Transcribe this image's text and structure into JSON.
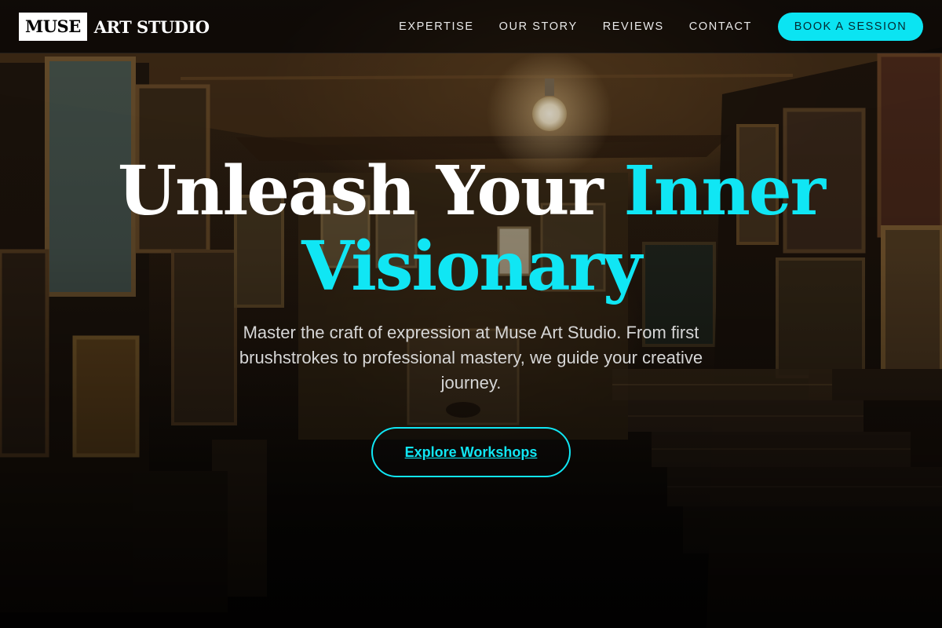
{
  "brand": {
    "logo_box": "MUSE",
    "logo_text": "ART STUDIO"
  },
  "nav": {
    "items": [
      {
        "label": "EXPERTISE"
      },
      {
        "label": "OUR STORY"
      },
      {
        "label": "REVIEWS"
      },
      {
        "label": "CONTACT"
      }
    ],
    "cta_label": "BOOK A SESSION"
  },
  "hero": {
    "headline_white": "Unleash Your ",
    "headline_cyan_1": "Inner",
    "headline_cyan_2": "Visionary",
    "subtext": "Master the craft of expression at Muse Art Studio. From first brushstrokes to professional mastery, we guide your creative journey.",
    "cta_label": "Explore Workshops"
  },
  "colors": {
    "accent": "#10e6f4",
    "accent_button": "#0be4f2",
    "header_bg": "#080605",
    "text_light": "#d6d6d6"
  },
  "icons": [
    "ceiling-lightbulb-icon"
  ]
}
